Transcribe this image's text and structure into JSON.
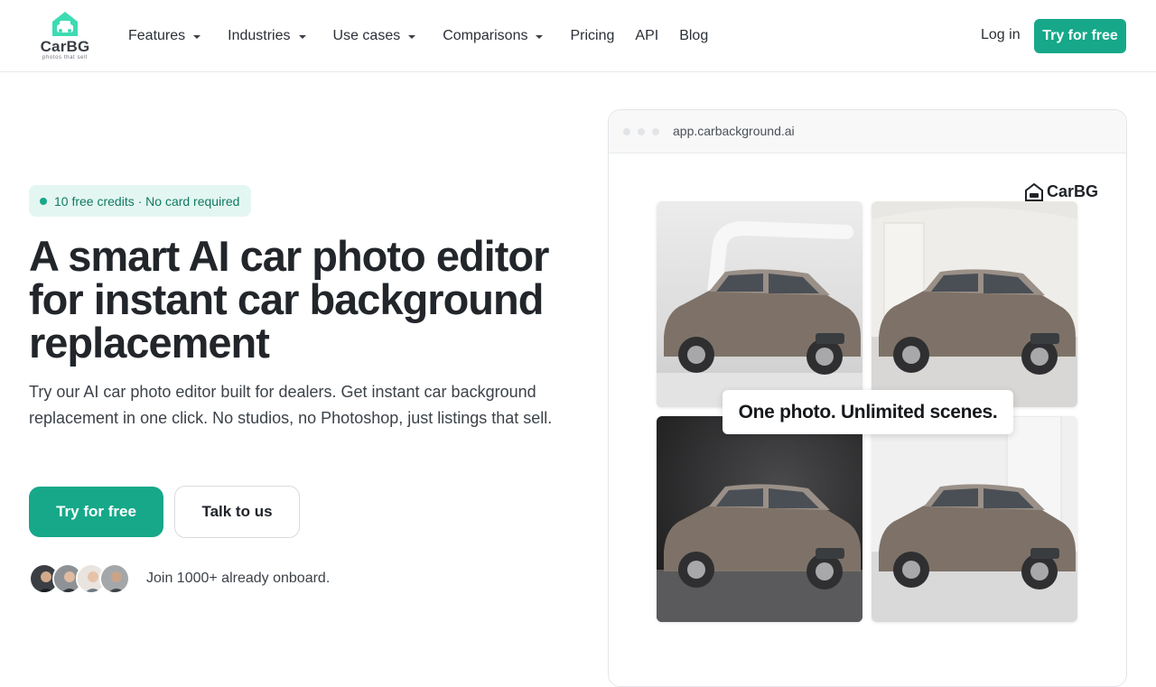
{
  "brand": {
    "name": "CarBG",
    "tagline": "photos that sell",
    "accent": "#16a889",
    "logo_icon": "car-garage-icon"
  },
  "nav": {
    "items": [
      {
        "label": "Features",
        "has_dropdown": true
      },
      {
        "label": "Industries",
        "has_dropdown": true
      },
      {
        "label": "Use cases",
        "has_dropdown": true
      },
      {
        "label": "Comparisons",
        "has_dropdown": true
      },
      {
        "label": "Pricing",
        "has_dropdown": false
      },
      {
        "label": "API",
        "has_dropdown": false
      },
      {
        "label": "Blog",
        "has_dropdown": false
      }
    ],
    "login": "Log in",
    "cta": "Try for free"
  },
  "hero": {
    "badge": "10 free credits · No card required",
    "headline": "A smart AI car photo editor for instant car background replacement",
    "subcopy": "Try our AI car photo editor built for dealers. Get instant car background replacement in one click. No studios, no Photoshop, just listings that sell.",
    "primary_cta": "Try for free",
    "secondary_cta": "Talk to us",
    "social_proof": "Join 1000+ already onboard."
  },
  "preview": {
    "url": "app.carbackground.ai",
    "logo_text": "CarBG",
    "caption": "One photo. Unlimited scenes.",
    "scenes": [
      "studio-curve",
      "white-showroom",
      "dark-studio",
      "bright-showroom"
    ]
  }
}
